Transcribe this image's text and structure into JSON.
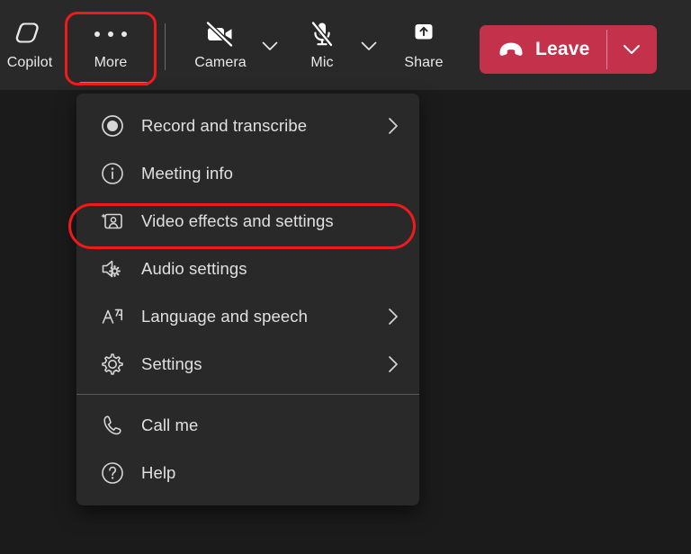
{
  "toolbar": {
    "buttons": [
      {
        "id": "copilot",
        "label": "Copilot",
        "icon": "copilot-icon"
      },
      {
        "id": "more",
        "label": "More",
        "icon": "more-dots-icon",
        "active": true
      },
      {
        "id": "camera",
        "label": "Camera",
        "icon": "camera-off-icon",
        "muted": true
      },
      {
        "id": "mic",
        "label": "Mic",
        "icon": "mic-off-icon",
        "muted": true
      },
      {
        "id": "share",
        "label": "Share",
        "icon": "share-screen-icon"
      }
    ],
    "camera_caret": "chevron-down-icon",
    "mic_caret": "chevron-down-icon",
    "leave": {
      "label": "Leave",
      "icon": "hang-up-icon",
      "caret": "chevron-down-icon",
      "color": "#c4314b"
    },
    "active_indicator_color": "#7b83eb",
    "background": "#292929"
  },
  "menu": {
    "background": "#292929",
    "groups": [
      {
        "items": [
          {
            "label": "Record and transcribe",
            "icon": "record-icon",
            "has_submenu": true
          },
          {
            "label": "Meeting info",
            "icon": "info-circle-icon",
            "has_submenu": false
          },
          {
            "label": "Video effects and settings",
            "icon": "video-effects-icon",
            "has_submenu": false,
            "highlighted": true
          },
          {
            "label": "Audio settings",
            "icon": "speaker-gear-icon",
            "has_submenu": false
          },
          {
            "label": "Language and speech",
            "icon": "translate-icon",
            "has_submenu": true
          },
          {
            "label": "Settings",
            "icon": "gear-icon",
            "has_submenu": true
          }
        ]
      },
      {
        "items": [
          {
            "label": "Call me",
            "icon": "phone-icon",
            "has_submenu": false
          },
          {
            "label": "Help",
            "icon": "help-circle-icon",
            "has_submenu": false
          }
        ]
      }
    ]
  },
  "annotations": {
    "color": "#ee1b1b",
    "highlights": [
      {
        "target": "more-button"
      },
      {
        "target": "video-effects-and-settings-menu-item"
      }
    ]
  }
}
